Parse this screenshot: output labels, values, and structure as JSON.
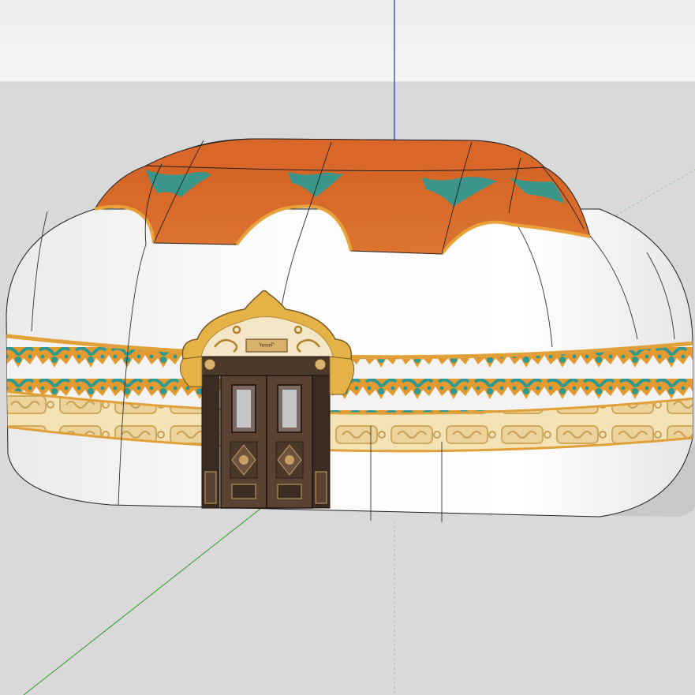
{
  "app": {
    "name": "",
    "scene": {
      "sky_color": "#f2f2f2",
      "ground_color": "#d9d9d9",
      "axis_colors": {
        "red": "#d9d9d9",
        "green": "#2f9a2f",
        "blue": "#2b2bd6"
      }
    },
    "model": {
      "object": "mongolian-yurt",
      "colors": {
        "roof": "#d96a2a",
        "roof_edge": "#e9a23a",
        "wall": "#f7f7f7",
        "trim_teal": "#2b9a94",
        "trim_gold": "#e8c06a",
        "door_wood": "#5a4232",
        "door_frame": "#e4b247"
      },
      "door": {
        "glyph_text": "ᠦᠣᠷ"
      }
    }
  }
}
